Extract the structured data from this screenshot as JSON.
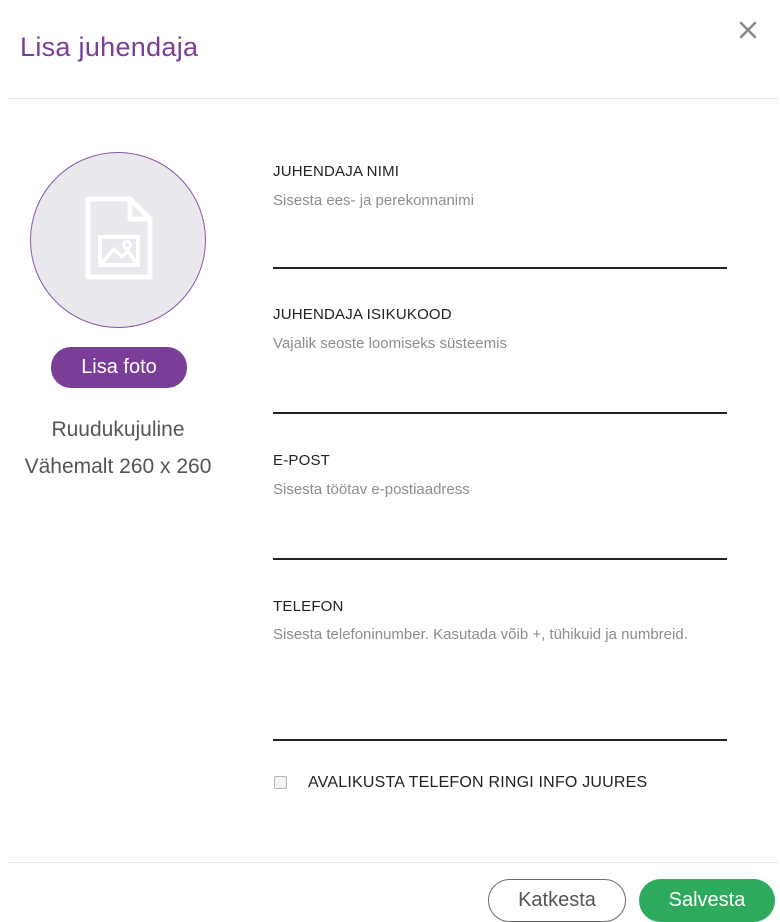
{
  "modal": {
    "title": "Lisa juhendaja",
    "close_icon": "close-icon"
  },
  "photo": {
    "placeholder_icon": "image-file-icon",
    "add_label": "Lisa foto",
    "hint_line1": "Ruudukujuline",
    "hint_line2": "Vähemalt 260 x 260"
  },
  "fields": [
    {
      "label": "JUHENDAJA NIMI",
      "hint": "Sisesta ees- ja perekonnanimi",
      "value": ""
    },
    {
      "label": "JUHENDAJA ISIKUKOOD",
      "hint": "Vajalik seoste loomiseks süsteemis",
      "value": ""
    },
    {
      "label": "E-POST",
      "hint": "Sisesta töötav e-postiaadress",
      "value": ""
    },
    {
      "label": "TELEFON",
      "hint": "Sisesta telefoninumber. Kasutada võib +, tühikuid ja numbreid.",
      "value": ""
    }
  ],
  "publish_phone": {
    "label": "AVALIKUSTA TELEFON RINGI INFO JUURES",
    "checked": false
  },
  "footer": {
    "cancel_label": "Katkesta",
    "save_label": "Salvesta"
  },
  "colors": {
    "accent": "#7a3d98",
    "save": "#2eaa5e"
  }
}
